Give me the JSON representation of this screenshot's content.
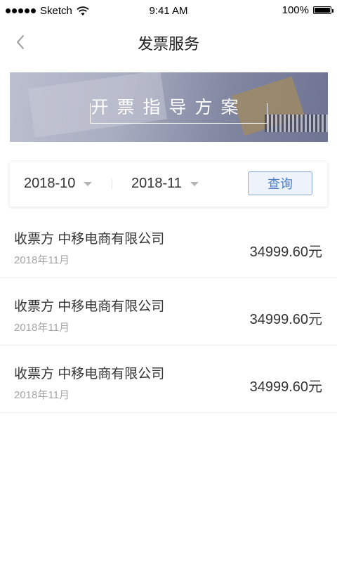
{
  "status_bar": {
    "carrier": "Sketch",
    "time": "9:41 AM",
    "battery": "100%",
    "battery_level": 1.0
  },
  "nav": {
    "title": "发票服务",
    "back_icon": "chevron-left-icon"
  },
  "banner": {
    "title": "开票指导方案"
  },
  "filter": {
    "start_month": "2018-10",
    "end_month": "2018-11",
    "query_label": "查询"
  },
  "invoices": [
    {
      "label": "收票方 中移电商有限公司",
      "date": "2018年11月",
      "amount": "34999.60元"
    },
    {
      "label": "收票方 中移电商有限公司",
      "date": "2018年11月",
      "amount": "34999.60元"
    },
    {
      "label": "收票方 中移电商有限公司",
      "date": "2018年11月",
      "amount": "34999.60元"
    }
  ],
  "colors": {
    "accent": "#4a7fd0",
    "accent_bg": "#edf2fb",
    "muted_text": "#a6a6a6"
  }
}
